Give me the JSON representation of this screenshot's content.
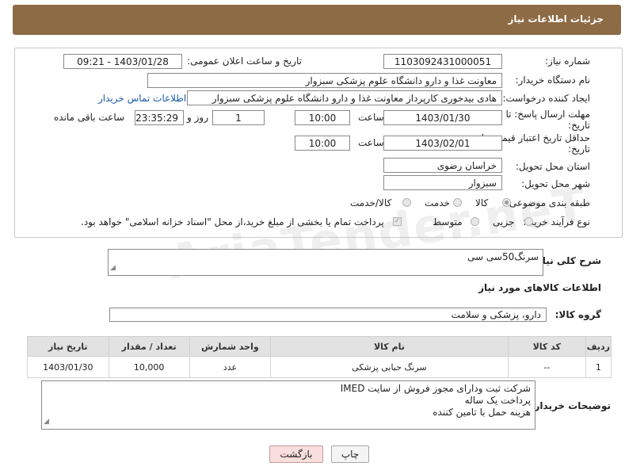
{
  "header": {
    "title": "جزئیات اطلاعات نیاز"
  },
  "fields": {
    "need_number_label": "شماره نیاز:",
    "need_number": "1103092431000051",
    "announce_label": "تاریخ و ساعت اعلان عمومی:",
    "announce_value": "1403/01/28 - 09:21",
    "buyer_org_label": "نام دستگاه خریدار:",
    "buyer_org": "معاونت غذا و دارو   دانشگاه علوم پزشکی سبزوار",
    "creator_label": "ایجاد کننده درخواست:",
    "creator": "هادی بیدخوری کارپرداز معاونت غذا و دارو   دانشگاه علوم پزشکی سبزوار",
    "contact_link": "اطلاعات تماس خریدار",
    "deadline_label_1": "مهلت ارسال پاسخ: تا",
    "deadline_label_2": "تاریخ:",
    "deadline_date": "1403/01/30",
    "time_label": "ساعت",
    "deadline_time": "10:00",
    "days_value": "1",
    "days_label": "روز و",
    "remaining_time": "23:35:29",
    "remaining_label": "ساعت باقی مانده",
    "validity_label_1": "حداقل تاریخ اعتبار قیمت: تا",
    "validity_label_2": "تاریخ:",
    "validity_date": "1403/02/01",
    "validity_time": "10:00",
    "province_label": "استان محل تحویل:",
    "province": "خراسان رضوی",
    "city_label": "شهر محل تحویل:",
    "city": "سبزوار",
    "category_label": "طبقه بندی موضوعی:",
    "category_options": [
      "کالا",
      "خدمت",
      "کالا/خدمت"
    ],
    "process_label": "نوع فرآیند خرید :",
    "process_options": [
      "جزیی",
      "متوسط"
    ],
    "payment_note": "پرداخت تمام یا بخشی از مبلغ خرید،از محل \"اسناد خزانه اسلامی\" خواهد بود."
  },
  "summary": {
    "label": "شرح کلی نیاز:",
    "value": "سرنگ50سی سی"
  },
  "goods": {
    "section_title": "اطلاعات کالاهای مورد نیاز",
    "group_label": "گروه کالا:",
    "group_value": "دارو، پزشکی و سلامت",
    "columns": [
      "ردیف",
      "کد کالا",
      "نام کالا",
      "واحد شمارش",
      "تعداد / مقدار",
      "تاریخ نیاز"
    ],
    "rows": [
      {
        "row": "1",
        "code": "--",
        "name": "سرنگ حبابی پزشکی",
        "unit": "عدد",
        "qty": "10,000",
        "date": "1403/01/30"
      }
    ]
  },
  "buyer_notes": {
    "label": "توضیحات خریدار:",
    "lines": [
      "شرکت ثبت ودارای مجوز فروش از سایت IMED",
      "پرداخت یک ساله",
      "هزینه حمل با تامین کننده"
    ]
  },
  "buttons": {
    "print": "چاپ",
    "back": "بازگشت"
  },
  "watermark": "AriaTender.neT"
}
